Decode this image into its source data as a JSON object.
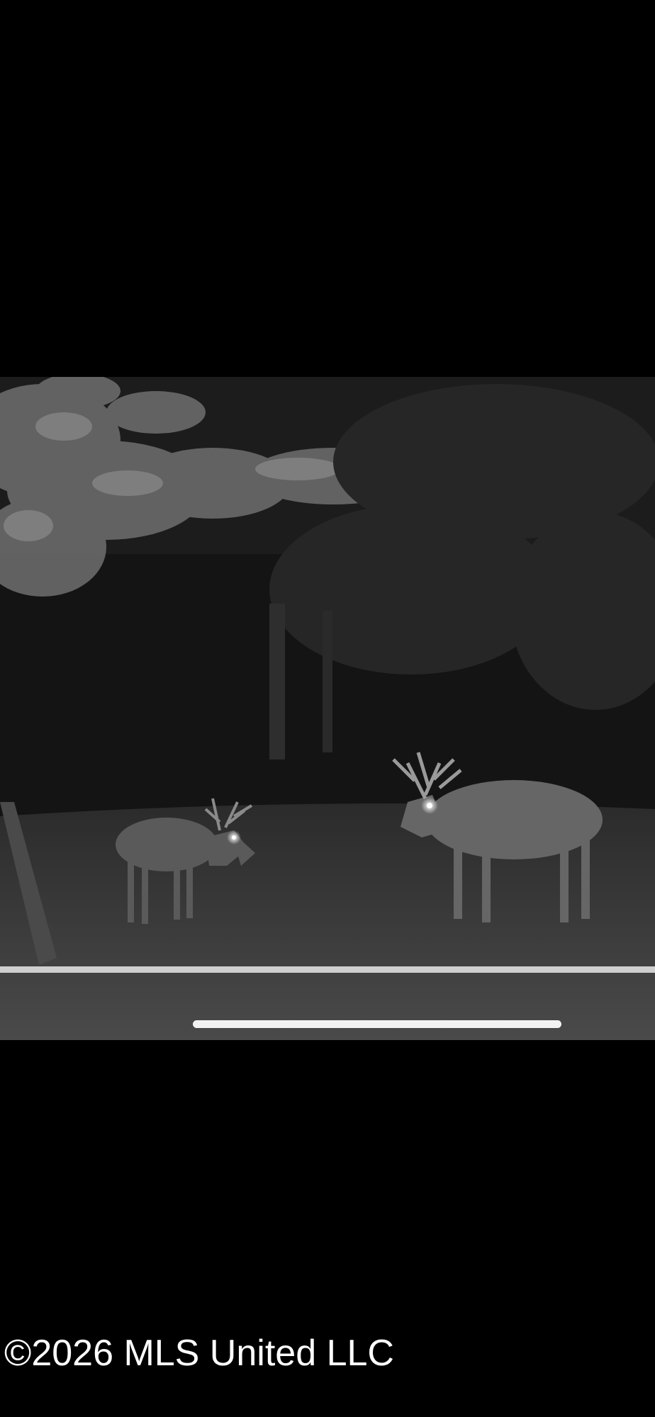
{
  "photo": {
    "subject": "night trail camera image of two antlered deer at a forest edge",
    "colors": {
      "background": "#000000",
      "scrub_line": "#cfcfcf",
      "home_indicator": "#f2f2f2"
    }
  },
  "footer": {
    "copyright": "©2026 MLS United LLC"
  }
}
